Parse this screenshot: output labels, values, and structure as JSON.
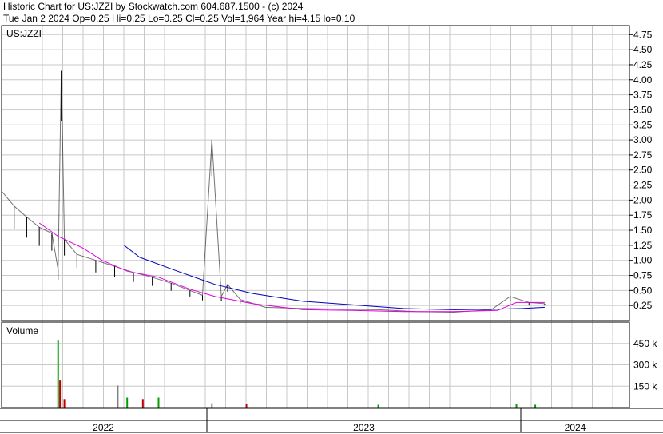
{
  "header": {
    "title": "Historic Chart for US:JZZI by Stockwatch.com 604.687.1500 - (c) 2024",
    "summary": "Tue Jan  2 2024   Op=0.25   Hi=0.25   Lo=0.25   Cl=0.25   Vol=1,964   Year hi=4.15   lo=0.10"
  },
  "chart_data": [
    {
      "type": "line",
      "title": "US:JZZI",
      "x_ticks": [
        "2022",
        "2023",
        "2024"
      ],
      "ylim": [
        0.0,
        4.9
      ],
      "y_ticks": [
        "4.75",
        "4.50",
        "4.25",
        "4.00",
        "3.75",
        "3.50",
        "3.25",
        "3.00",
        "2.75",
        "2.50",
        "2.25",
        "2.00",
        "1.75",
        "1.50",
        "1.25",
        "1.00",
        "0.75",
        "0.50",
        "0.25"
      ],
      "grid": true,
      "series": [
        {
          "kind": "price-bars",
          "color": "#000000",
          "points": [
            {
              "x": 0.0,
              "y": 2.15
            },
            {
              "x": 0.02,
              "y": 1.9
            },
            {
              "x": 0.04,
              "y": 1.72
            },
            {
              "x": 0.06,
              "y": 1.55
            },
            {
              "x": 0.08,
              "y": 1.45
            },
            {
              "x": 0.09,
              "y": 0.85
            },
            {
              "x": 0.095,
              "y": 4.15
            },
            {
              "x": 0.1,
              "y": 1.35
            },
            {
              "x": 0.12,
              "y": 1.1
            },
            {
              "x": 0.15,
              "y": 1.0
            },
            {
              "x": 0.18,
              "y": 0.9
            },
            {
              "x": 0.21,
              "y": 0.8
            },
            {
              "x": 0.24,
              "y": 0.72
            },
            {
              "x": 0.27,
              "y": 0.62
            },
            {
              "x": 0.3,
              "y": 0.5
            },
            {
              "x": 0.32,
              "y": 0.42
            },
            {
              "x": 0.335,
              "y": 3.0
            },
            {
              "x": 0.35,
              "y": 0.4
            },
            {
              "x": 0.36,
              "y": 0.6
            },
            {
              "x": 0.38,
              "y": 0.35
            },
            {
              "x": 0.42,
              "y": 0.22
            },
            {
              "x": 0.48,
              "y": 0.2
            },
            {
              "x": 0.54,
              "y": 0.19
            },
            {
              "x": 0.6,
              "y": 0.18
            },
            {
              "x": 0.66,
              "y": 0.15
            },
            {
              "x": 0.72,
              "y": 0.14
            },
            {
              "x": 0.78,
              "y": 0.18
            },
            {
              "x": 0.81,
              "y": 0.4
            },
            {
              "x": 0.84,
              "y": 0.3
            },
            {
              "x": 0.865,
              "y": 0.28
            }
          ]
        },
        {
          "kind": "moving-average-short",
          "color": "#e000e0",
          "points": [
            {
              "x": 0.06,
              "y": 1.62
            },
            {
              "x": 0.09,
              "y": 1.4
            },
            {
              "x": 0.13,
              "y": 1.2
            },
            {
              "x": 0.16,
              "y": 1.0
            },
            {
              "x": 0.2,
              "y": 0.82
            },
            {
              "x": 0.25,
              "y": 0.72
            },
            {
              "x": 0.3,
              "y": 0.52
            },
            {
              "x": 0.34,
              "y": 0.4
            },
            {
              "x": 0.4,
              "y": 0.28
            },
            {
              "x": 0.48,
              "y": 0.18
            },
            {
              "x": 0.56,
              "y": 0.17
            },
            {
              "x": 0.64,
              "y": 0.15
            },
            {
              "x": 0.72,
              "y": 0.15
            },
            {
              "x": 0.79,
              "y": 0.17
            },
            {
              "x": 0.82,
              "y": 0.3
            },
            {
              "x": 0.865,
              "y": 0.3
            }
          ]
        },
        {
          "kind": "moving-average-long",
          "color": "#0000c0",
          "points": [
            {
              "x": 0.195,
              "y": 1.25
            },
            {
              "x": 0.22,
              "y": 1.05
            },
            {
              "x": 0.28,
              "y": 0.82
            },
            {
              "x": 0.34,
              "y": 0.6
            },
            {
              "x": 0.4,
              "y": 0.45
            },
            {
              "x": 0.48,
              "y": 0.32
            },
            {
              "x": 0.56,
              "y": 0.26
            },
            {
              "x": 0.64,
              "y": 0.2
            },
            {
              "x": 0.72,
              "y": 0.18
            },
            {
              "x": 0.79,
              "y": 0.19
            },
            {
              "x": 0.83,
              "y": 0.2
            },
            {
              "x": 0.865,
              "y": 0.22
            }
          ]
        }
      ]
    },
    {
      "type": "bar",
      "title": "Volume",
      "ylim": [
        0,
        600000
      ],
      "y_ticks": [
        "450 k",
        "300 k",
        "150 k"
      ],
      "grid": true,
      "bars": [
        {
          "x": 0.09,
          "value": 470000,
          "color": "#00a000"
        },
        {
          "x": 0.093,
          "value": 190000,
          "color": "#c00000"
        },
        {
          "x": 0.1,
          "value": 60000,
          "color": "#c00000"
        },
        {
          "x": 0.185,
          "value": 155000,
          "color": "#808080"
        },
        {
          "x": 0.2,
          "value": 70000,
          "color": "#00a000"
        },
        {
          "x": 0.225,
          "value": 60000,
          "color": "#c00000"
        },
        {
          "x": 0.25,
          "value": 70000,
          "color": "#00a000"
        },
        {
          "x": 0.335,
          "value": 30000,
          "color": "#808080"
        },
        {
          "x": 0.39,
          "value": 25000,
          "color": "#c00000"
        },
        {
          "x": 0.6,
          "value": 20000,
          "color": "#00a000"
        },
        {
          "x": 0.82,
          "value": 25000,
          "color": "#00a000"
        },
        {
          "x": 0.85,
          "value": 20000,
          "color": "#00a000"
        }
      ]
    }
  ]
}
